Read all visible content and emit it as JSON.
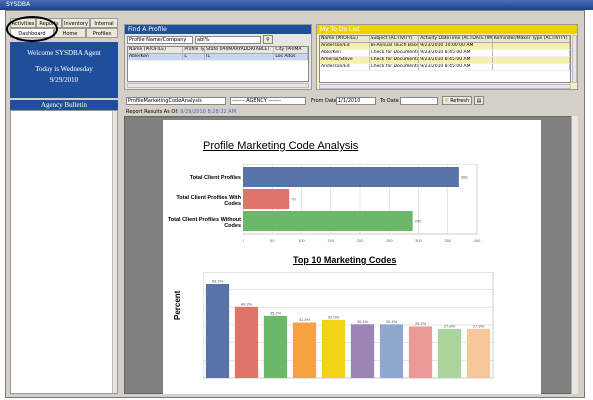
{
  "window": {
    "title": "SYSDBA"
  },
  "nav_tabs": [
    {
      "label": "Activities"
    },
    {
      "label": "Reports"
    },
    {
      "label": "Inventory"
    },
    {
      "label": "Internal"
    },
    {
      "label": "Dashboard"
    },
    {
      "label": "Home"
    },
    {
      "label": "Profiles"
    }
  ],
  "welcome": {
    "line1": "Welcome SYSDBA Agent",
    "line2": "Today is Wednesday",
    "line3": "9/29/2010"
  },
  "bulletin": {
    "title": "Agency Bulletin"
  },
  "find_profile": {
    "title": "Find A Profile",
    "search_by": "Profile Name/Company",
    "search_value": "abl%",
    "columns": [
      "Name (PROFILE)",
      "Profile Typ",
      "State (PRIMARYADDRTABLE)",
      "City (PRIMA"
    ],
    "rows": [
      [
        "Able/Ken",
        "L",
        "IL",
        "Los Altos"
      ]
    ]
  },
  "todo": {
    "title": "My To Do List",
    "columns": [
      "Name (PROFILE)",
      "Subject (ACTIVITY)",
      "Activity DateTime (ACTDATETIME)",
      "Reminder/Maker Type (ACTIVITY)"
    ],
    "rows": [
      [
        "Anderson/Ed",
        "Bi-Annual Touch Base",
        "9/23/2010 10:00:00 AM",
        ""
      ],
      [
        "Able/Ken",
        "Check for Documents",
        "9/23/2010 8:45:00 AM",
        ""
      ],
      [
        "Amerail/Steve",
        "Check for Documents",
        "9/23/2010 8:45:00 AM",
        ""
      ],
      [
        "Anderson/Ed",
        "Check for Documents",
        "9/23/2010 8:45:00 AM",
        ""
      ]
    ]
  },
  "toolbar": {
    "report": "ProfileMarketingCodeAnalysis",
    "agency": "------- AGENCY -------",
    "from_label": "From Date",
    "from_value": "1/1/2010",
    "to_label": "To Date",
    "to_value": "",
    "refresh": "Refresh"
  },
  "report_as_of": {
    "label": "Report Results As Of:",
    "value": "9/29/2010 8:28:22 AM"
  },
  "colors": {
    "blue_header": "#1f4f9c",
    "todo_header": "#f0d200",
    "bar_blue": "#5873a8",
    "bar_red": "#e07468",
    "bar_green": "#6cb86a"
  },
  "chart_data": [
    {
      "type": "bar",
      "orientation": "horizontal",
      "title": "Profile Marketing Code Analysis",
      "categories": [
        "Total Client Profiles",
        "Total Client Profiles With Codes",
        "Total Client Profiles Without Codes"
      ],
      "values": [
        369,
        79,
        290
      ],
      "colors": [
        "#5873a8",
        "#e07468",
        "#6cb86a"
      ],
      "xlim": [
        0,
        400
      ],
      "xticks": [
        0,
        50,
        100,
        150,
        200,
        250,
        300,
        350,
        400
      ],
      "grid": true
    },
    {
      "type": "bar",
      "title": "Top 10 Marketing Codes",
      "ylabel": "Percent",
      "values": [
        53.2,
        40.3,
        35.2,
        31.4,
        32.9,
        30.4,
        30.4,
        29.2,
        27.8,
        27.8
      ],
      "labels": [
        "53.2%",
        "40.3%",
        "35.2%",
        "31.4%",
        "32.9%",
        "30.4%",
        "30.4%",
        "29.2%",
        "27.8%",
        "27.8%"
      ],
      "colors": [
        "#5873a8",
        "#e07468",
        "#6cb86a",
        "#f4a340",
        "#f1d417",
        "#9c84b5",
        "#8fa8d0",
        "#e99a96",
        "#a9d49c",
        "#f7c79c"
      ],
      "ylim": [
        0,
        60
      ],
      "grid": true
    }
  ]
}
